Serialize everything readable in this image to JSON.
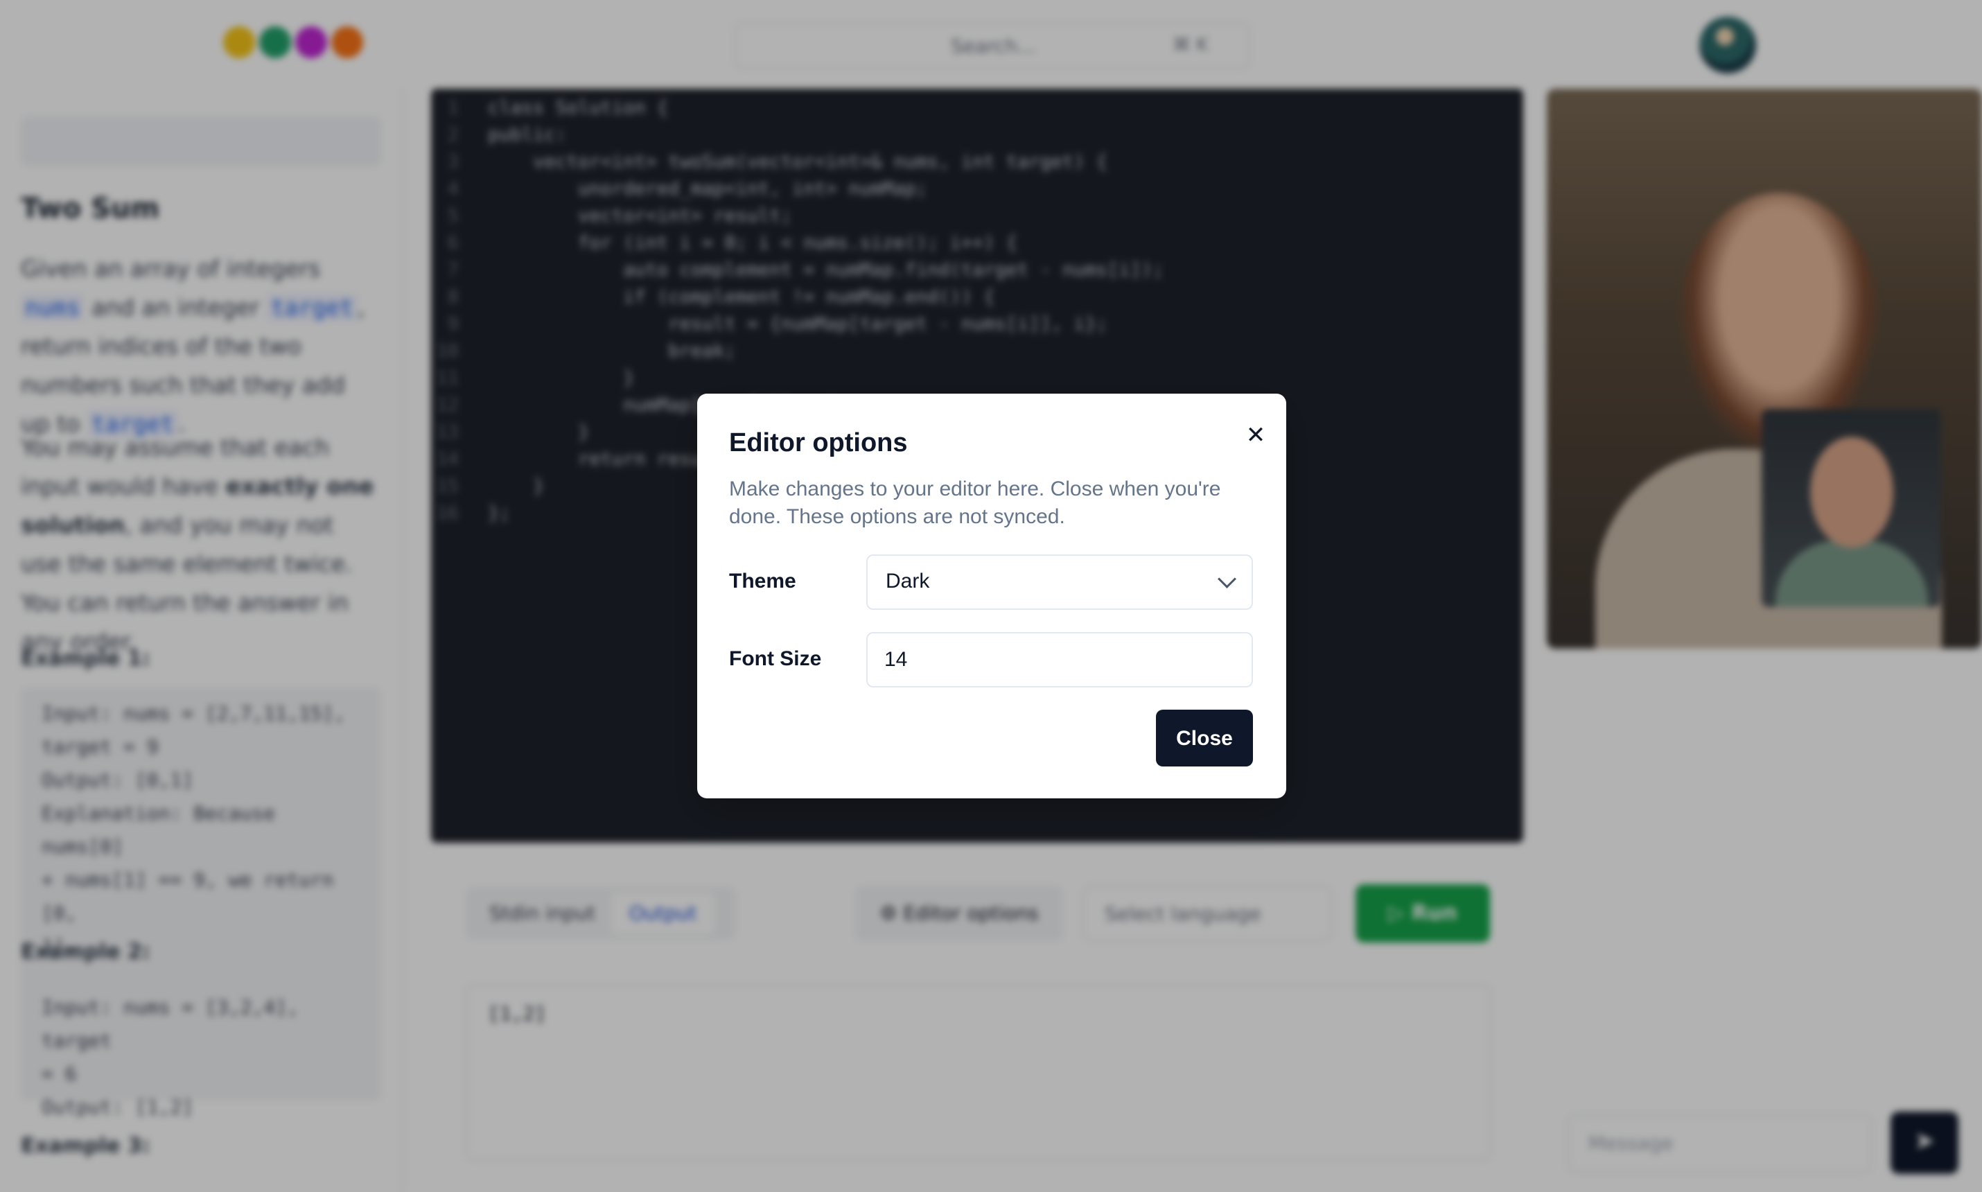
{
  "header": {
    "search_placeholder": "Search...",
    "search_shortcut": "⌘ K",
    "logo_colors": [
      "#f5c518",
      "#22a06b",
      "#c026d3",
      "#f97316"
    ]
  },
  "problem": {
    "title": "Two Sum",
    "para1_a": "Given an array of integers ",
    "para1_nums": "nums",
    "para1_b": " and an integer ",
    "para1_target": "target",
    "para1_c": ", return indices of the two numbers such that they add up to ",
    "para1_target2": "target",
    "para1_d": ".",
    "para2_a": "You may assume that each input would have ",
    "para2_bold": "exactly one solution",
    "para2_b": ", and you may not use the same element twice. You can return the answer in any order.",
    "example1_title": "Example 1:",
    "example1_lines": [
      "Input: nums = [2,7,11,15],",
      "target = 9",
      "Output: [0,1]",
      "Explanation: Because nums[0]",
      "+ nums[1] == 9, we return [0,",
      "1]."
    ],
    "example2_title": "Example 2:",
    "example2_lines": [
      "Input: nums = [3,2,4], target",
      "= 6",
      "Output: [1,2]"
    ],
    "example3_title": "Example 3:"
  },
  "editor": {
    "lines": [
      "class Solution {",
      "public:",
      "    vector<int> twoSum(vector<int>& nums, int target) {",
      "        unordered_map<int, int> numMap;",
      "        vector<int> result;",
      "        for (int i = 0; i < nums.size(); i++) {",
      "            auto complement = numMap.find(target - nums[i]);",
      "            if (complement != numMap.end()) {",
      "                result = {numMap[target - nums[i]], i};",
      "                break;",
      "            }",
      "            numMap[nums[i]] = i;",
      "        }",
      "        return result;",
      "    }",
      "};"
    ]
  },
  "controls": {
    "tab_stdin": "Stdin input",
    "tab_output": "Output",
    "editor_options": "Editor options",
    "select_language": "Select language",
    "run": "Run",
    "output_value": "[1,2]",
    "run_color": "#16a34a"
  },
  "chat": {
    "message_placeholder": "Message"
  },
  "dialog": {
    "title": "Editor options",
    "description": "Make changes to your editor here. Close when you're done. These options are not synced.",
    "theme_label": "Theme",
    "theme_value": "Dark",
    "font_size_label": "Font Size",
    "font_size_value": "14",
    "close_label": "Close"
  }
}
